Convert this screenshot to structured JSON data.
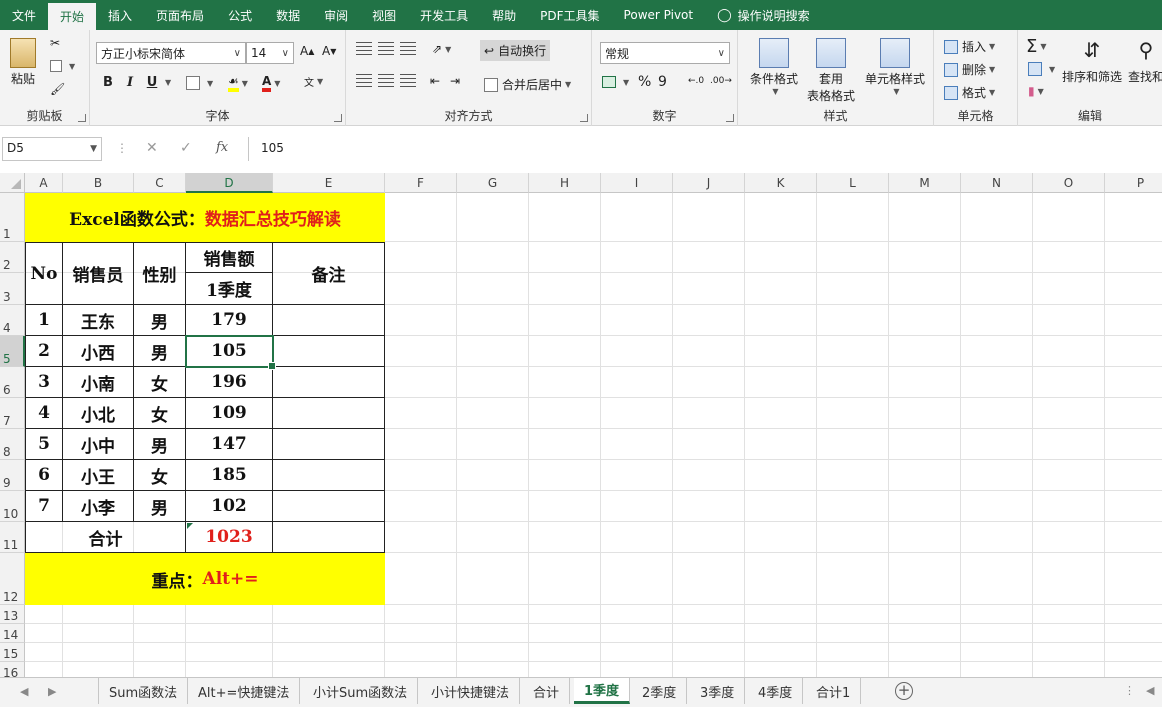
{
  "ribbon_tabs": [
    "文件",
    "开始",
    "插入",
    "页面布局",
    "公式",
    "数据",
    "审阅",
    "视图",
    "开发工具",
    "帮助",
    "PDF工具集",
    "Power Pivot",
    "操作说明搜索"
  ],
  "ribbon": {
    "clipboard": {
      "label": "剪贴板",
      "paste": "粘贴"
    },
    "font": {
      "label": "字体",
      "family": "方正小标宋简体",
      "size": "14",
      "bold": "B",
      "italic": "I",
      "underline": "U"
    },
    "alignment": {
      "label": "对齐方式",
      "wrap": "自动换行",
      "merge": "合并后居中"
    },
    "number": {
      "label": "数字",
      "format": "常规",
      "percent": "%",
      "comma": "9"
    },
    "styles": {
      "label": "样式",
      "conditional": "条件格式",
      "table": "套用",
      "table2": "表格格式",
      "cell": "单元格样式"
    },
    "cells": {
      "label": "单元格",
      "insert": "插入",
      "delete": "删除",
      "format": "格式"
    },
    "editing": {
      "label": "编辑",
      "sort": "排序和筛选",
      "find": "查找和"
    }
  },
  "formula_bar": {
    "name_box": "D5",
    "value": "105",
    "fx": "fx"
  },
  "columns": [
    "A",
    "B",
    "C",
    "D",
    "E",
    "F",
    "G",
    "H",
    "I",
    "J",
    "K",
    "L",
    "M",
    "N",
    "O",
    "P"
  ],
  "rows": [
    "1",
    "2",
    "3",
    "4",
    "5",
    "6",
    "7",
    "8",
    "9",
    "10",
    "11",
    "12",
    "13",
    "14",
    "15",
    "16"
  ],
  "sheet": {
    "title_prefix": "Excel函数公式：",
    "title_suffix": "数据汇总技巧解读",
    "headers": {
      "no": "No",
      "seller": "销售员",
      "gender": "性别",
      "sales": "销售额",
      "quarter": "1季度",
      "note": "备注"
    },
    "records": [
      {
        "no": "1",
        "name": "王东",
        "gender": "男",
        "q1": "179"
      },
      {
        "no": "2",
        "name": "小西",
        "gender": "男",
        "q1": "105"
      },
      {
        "no": "3",
        "name": "小南",
        "gender": "女",
        "q1": "196"
      },
      {
        "no": "4",
        "name": "小北",
        "gender": "女",
        "q1": "109"
      },
      {
        "no": "5",
        "name": "小中",
        "gender": "男",
        "q1": "147"
      },
      {
        "no": "6",
        "name": "小王",
        "gender": "女",
        "q1": "185"
      },
      {
        "no": "7",
        "name": "小李",
        "gender": "男",
        "q1": "102"
      }
    ],
    "total_label": "合计",
    "total_value": "1023",
    "key_prefix": "重点：",
    "key_suffix": "Alt+="
  },
  "sheet_tabs": [
    "Sum函数法",
    "Alt+=快捷键法",
    "小计Sum函数法",
    "小计快捷键法",
    "合计",
    "1季度",
    "2季度",
    "3季度",
    "4季度",
    "合计1"
  ],
  "active_sheet": "1季度",
  "colors": {
    "excel_green": "#217346",
    "highlight_yellow": "#ffff00",
    "accent_red": "#e0201b"
  }
}
